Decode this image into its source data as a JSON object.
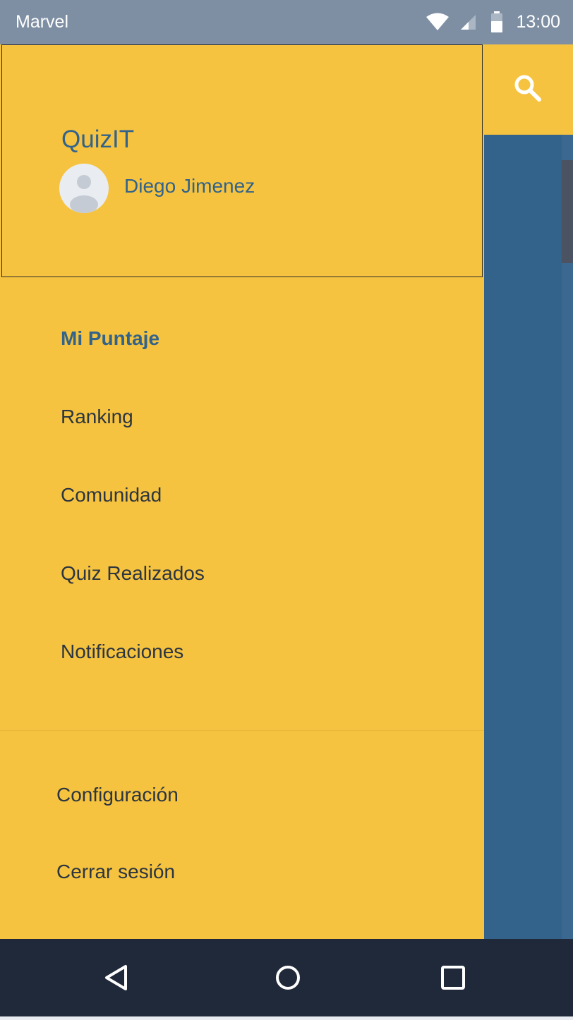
{
  "status_bar": {
    "app_name": "Marvel",
    "time": "13:00",
    "wifi_icon": "wifi-icon",
    "signal_icon": "cell-signal-icon",
    "battery_icon": "battery-icon"
  },
  "toolbar": {
    "search_icon": "search-icon"
  },
  "drawer": {
    "title": "QuizIT",
    "user_name": "Diego Jimenez",
    "avatar_icon": "user-avatar-icon",
    "items": [
      {
        "label": "Mi Puntaje",
        "active": true
      },
      {
        "label": "Ranking",
        "active": false
      },
      {
        "label": "Comunidad",
        "active": false
      },
      {
        "label": "Quiz Realizados",
        "active": false
      },
      {
        "label": "Notificaciones",
        "active": false
      }
    ],
    "footer_items": [
      {
        "label": "Configuración"
      },
      {
        "label": "Cerrar sesión"
      }
    ]
  },
  "nav_bar": {
    "back_icon": "back-triangle-icon",
    "home_icon": "home-circle-icon",
    "recents_icon": "recents-square-icon"
  },
  "colors": {
    "accent_yellow": "#f5c33f",
    "brand_blue": "#33628a",
    "status_bar": "#7e8fa3",
    "nav_bar": "#20293a"
  }
}
